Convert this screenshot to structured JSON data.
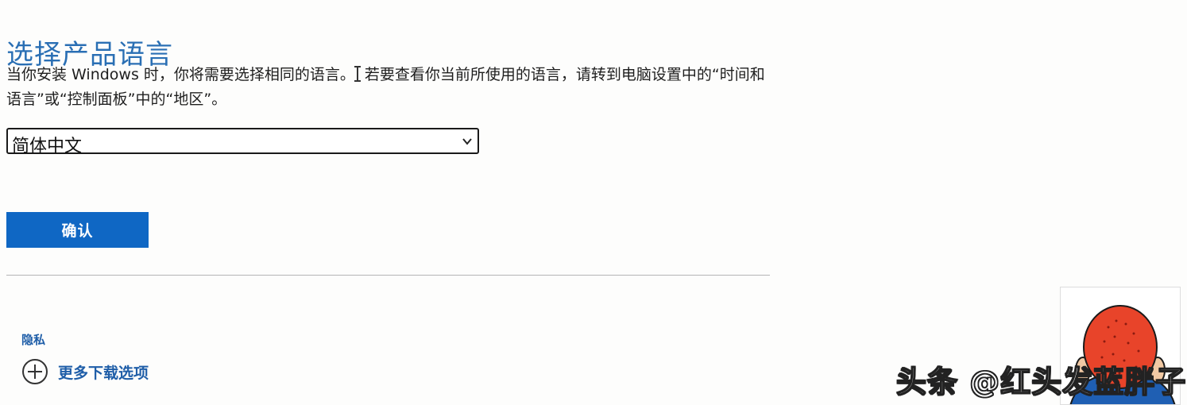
{
  "page": {
    "title": "选择产品语言",
    "description_before_cursor": "当你安装 Windows 时，你将需要选择相同的语言。",
    "description_after_cursor": "若要查看你当前所使用的语言，请转到电脑设置中的“时间和语言”或“控制面板”中的“地区”。"
  },
  "language_select": {
    "selected": "简体中文",
    "icon": "chevron-down-icon"
  },
  "buttons": {
    "confirm": "确认"
  },
  "footer": {
    "privacy": "隐私",
    "more_downloads": "更多下载选项",
    "more_downloads_icon": "plus-circle-icon"
  },
  "overlay": {
    "watermark": "头条 @红头发蓝胖子"
  },
  "colors": {
    "title": "#2a6fb4",
    "button_bg": "#0f67c4",
    "link": "#1f5ea8"
  }
}
